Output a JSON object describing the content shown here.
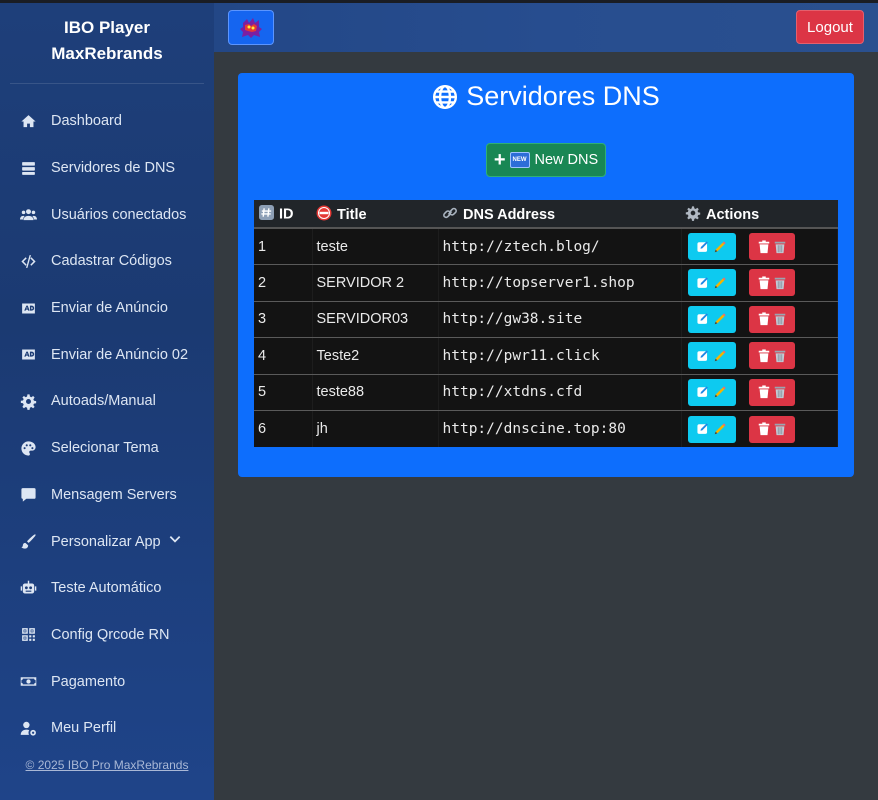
{
  "brand": {
    "line1": "IBO Player",
    "line2": "MaxRebrands"
  },
  "sidebar": {
    "items": [
      {
        "label": "Dashboard",
        "icon": "home-icon"
      },
      {
        "label": "Servidores de DNS",
        "icon": "server-icon"
      },
      {
        "label": "Usuários conectados",
        "icon": "users-icon"
      },
      {
        "label": "Cadastrar Códigos",
        "icon": "code-icon"
      },
      {
        "label": "Enviar de Anúncio",
        "icon": "ad-icon"
      },
      {
        "label": "Enviar de Anúncio 02",
        "icon": "ad-icon"
      },
      {
        "label": "Autoads/Manual",
        "icon": "gear-icon"
      },
      {
        "label": "Selecionar Tema",
        "icon": "palette-icon"
      },
      {
        "label": "Mensagem Servers",
        "icon": "comment-icon"
      },
      {
        "label": "Personalizar App",
        "icon": "brush-icon"
      },
      {
        "label": "Teste Automático",
        "icon": "robot-icon"
      },
      {
        "label": "Config Qrcode RN",
        "icon": "qrcode-icon"
      },
      {
        "label": "Pagamento",
        "icon": "money-icon"
      },
      {
        "label": "Meu Perfil",
        "icon": "user-gear-icon"
      }
    ],
    "footer": "© 2025 IBO Pro MaxRebrands"
  },
  "topbar": {
    "logout_label": "Logout"
  },
  "main": {
    "title": "Servidores DNS",
    "new_button_label": "New DNS",
    "new_badge": "NEW",
    "columns": {
      "id": "ID",
      "title": "Title",
      "dns": "DNS Address",
      "actions": "Actions"
    },
    "rows": [
      {
        "id": "1",
        "title": "teste",
        "dns": "http://ztech.blog/"
      },
      {
        "id": "2",
        "title": "SERVIDOR 2",
        "dns": "http://topserver1.shop"
      },
      {
        "id": "3",
        "title": "SERVIDOR03",
        "dns": "http://gw38.site"
      },
      {
        "id": "4",
        "title": "Teste2",
        "dns": "http://pwr11.click"
      },
      {
        "id": "5",
        "title": "teste88",
        "dns": "http://xtdns.cfd"
      },
      {
        "id": "6",
        "title": "jh",
        "dns": "http://dnscine.top:80"
      }
    ]
  },
  "colors": {
    "sidebar": "#1e3f7a",
    "card": "#0d6efd",
    "success": "#198754",
    "danger": "#dc3545",
    "info": "#0dcaf0",
    "dns_text": "#e83e8c"
  }
}
